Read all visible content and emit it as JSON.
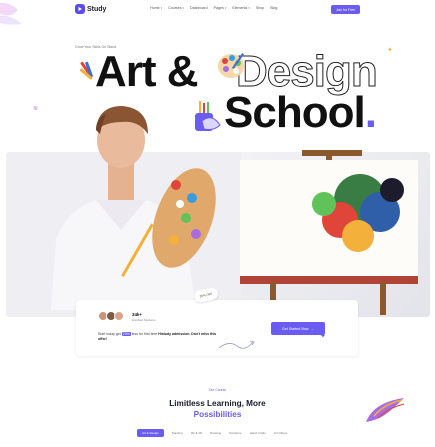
{
  "header": {
    "brand": "Study",
    "nav": [
      {
        "label": "Home",
        "caret": true
      },
      {
        "label": "Courses",
        "caret": true
      },
      {
        "label": "Dashboard",
        "caret": false
      },
      {
        "label": "Pages",
        "caret": true
      },
      {
        "label": "Elements",
        "caret": true
      },
      {
        "label": "Shop",
        "caret": false
      },
      {
        "label": "Blog",
        "caret": false
      }
    ],
    "join_label": "Join for Free"
  },
  "hero": {
    "eyebrow": "Grow Your Skills On Stand",
    "line1": "Art &",
    "design": "Design",
    "line2": "School",
    "period": "."
  },
  "card": {
    "count": "34k+",
    "count_label": "Enrolled Students",
    "offer_before": "Start today get",
    "offer_pct": "20%",
    "offer_mid": "less for first time",
    "offer_brand": "Histudy",
    "offer_after": "admission. Don't miss this offer!",
    "sticker": "20% OFF",
    "start_label": "Get Started Now",
    "start_arrow": "→"
  },
  "section": {
    "eyebrow": "Our Course",
    "title_line1": "Limitless Learning, More",
    "title_accent": "Possibilities",
    "tabs": [
      "Art & Design",
      "Painting",
      "3D & 2D",
      "Drawing",
      "Sculpture",
      "Hand Crafts",
      "Art Others"
    ]
  },
  "colors": {
    "accent": "#6a5cf0",
    "text": "#1a1a2e",
    "band_bg": "#eeeef3"
  }
}
